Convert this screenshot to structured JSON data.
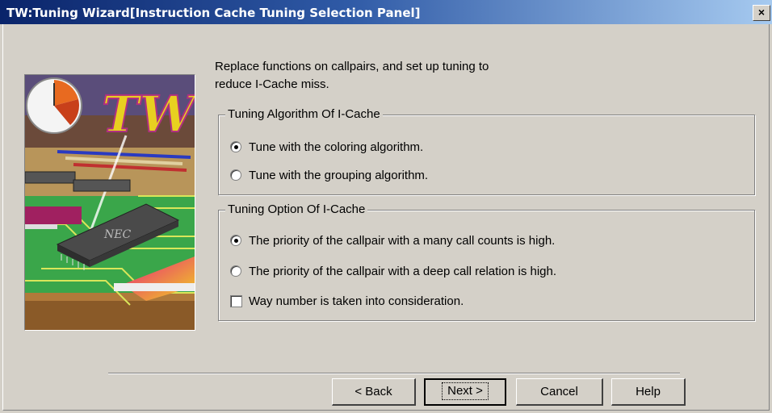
{
  "window": {
    "title": "TW:Tuning Wizard[Instruction Cache Tuning Selection Panel]",
    "close_label": "×"
  },
  "illustration": {
    "logo_text": "TW",
    "chip_label": "NEC"
  },
  "intro": {
    "line1": "Replace functions on callpairs, and set up tuning to",
    "line2": "reduce I-Cache miss."
  },
  "algorithm_group": {
    "legend": "Tuning Algorithm Of I-Cache",
    "options": [
      {
        "label": "Tune with the coloring algorithm.",
        "checked": true
      },
      {
        "label": "Tune with the grouping algorithm.",
        "checked": false
      }
    ]
  },
  "option_group": {
    "legend": "Tuning Option Of I-Cache",
    "options": [
      {
        "label": "The priority of the callpair with a many call counts is high.",
        "checked": true
      },
      {
        "label": "The priority of the callpair with a deep call relation is high.",
        "checked": false
      }
    ],
    "checkbox": {
      "label": "Way number is taken into consideration.",
      "checked": false
    }
  },
  "buttons": {
    "back": "< Back",
    "next": "Next >",
    "cancel": "Cancel",
    "help": "Help"
  }
}
